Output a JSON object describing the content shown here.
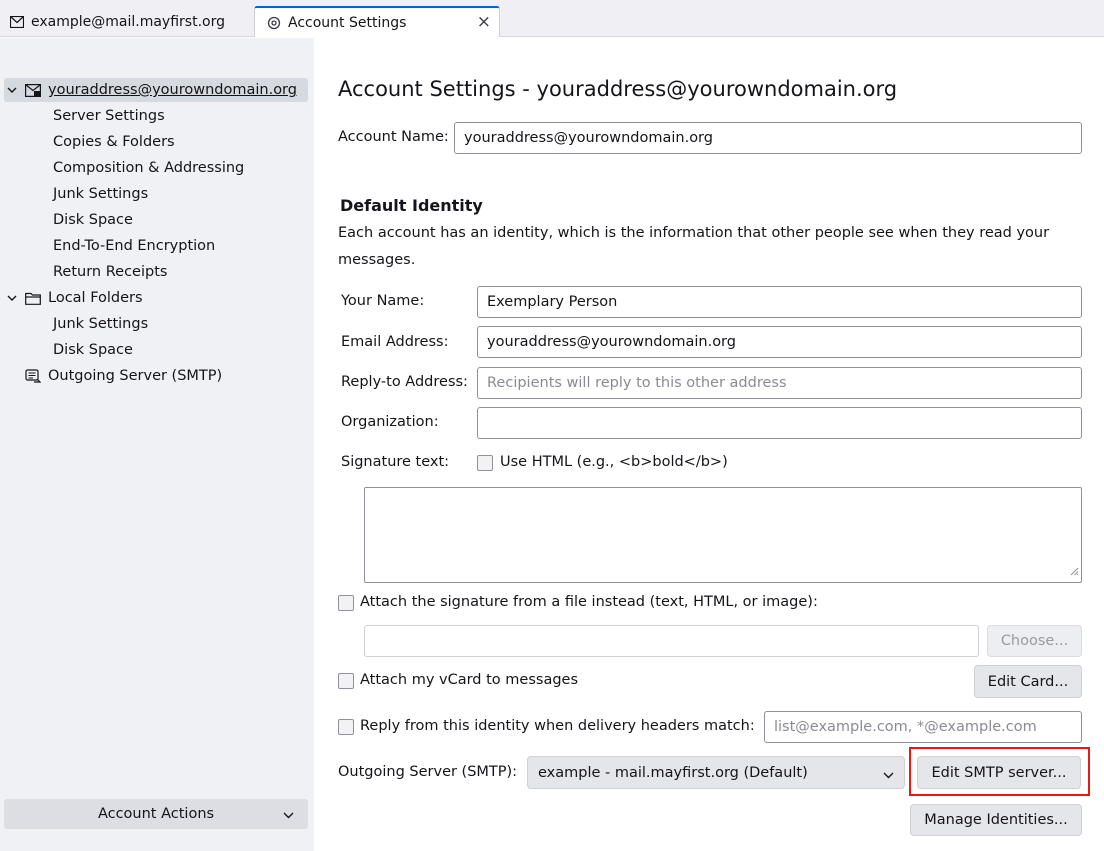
{
  "tabs": [
    {
      "label": "example@mail.mayfirst.org",
      "icon": "envelope-icon"
    },
    {
      "label": "Account Settings",
      "icon": "settings-icon",
      "close": "×"
    }
  ],
  "sidebar": {
    "account": {
      "label": "youraddress@yourowndomain.org",
      "icon": "mail-account-icon"
    },
    "account_items": [
      "Server Settings",
      "Copies & Folders",
      "Composition & Addressing",
      "Junk Settings",
      "Disk Space",
      "End-To-End Encryption",
      "Return Receipts"
    ],
    "local_folders": {
      "label": "Local Folders",
      "icon": "folder-icon"
    },
    "local_items": [
      "Junk Settings",
      "Disk Space"
    ],
    "smtp": {
      "label": "Outgoing Server (SMTP)",
      "icon": "outgoing-server-icon"
    },
    "account_actions": "Account Actions"
  },
  "main": {
    "title": "Account Settings - youraddress@yourowndomain.org",
    "account_name_label": "Account Name:",
    "account_name_value": "youraddress@yourowndomain.org",
    "default_identity": "Default Identity",
    "identity_description": "Each account has an identity, which is the information that other people see when they read your messages.",
    "your_name_label": "Your Name:",
    "your_name_value": "Exemplary Person",
    "email_label": "Email Address:",
    "email_value": "youraddress@yourowndomain.org",
    "reply_to_label": "Reply-to Address:",
    "reply_to_placeholder": "Recipients will reply to this other address",
    "organization_label": "Organization:",
    "organization_value": "",
    "signature_label": "Signature text:",
    "use_html_label": "Use HTML (e.g., <b>bold</b>)",
    "attach_sig_label": "Attach the signature from a file instead (text, HTML, or image):",
    "sig_file_value": "",
    "choose_button": "Choose...",
    "vcard_label": "Attach my vCard to messages",
    "edit_card_button": "Edit Card...",
    "reply_from_label": "Reply from this identity when delivery headers match:",
    "reply_from_placeholder": "list@example.com, *@example.com",
    "smtp_label": "Outgoing Server (SMTP):",
    "smtp_value": "example - mail.mayfirst.org (Default)",
    "edit_smtp_button": "Edit SMTP server...",
    "manage_identities_button": "Manage Identities..."
  },
  "colors": {
    "accent": "#0061e0",
    "highlight": "#e01b1b",
    "sidebar_bg": "#eff1f4"
  }
}
